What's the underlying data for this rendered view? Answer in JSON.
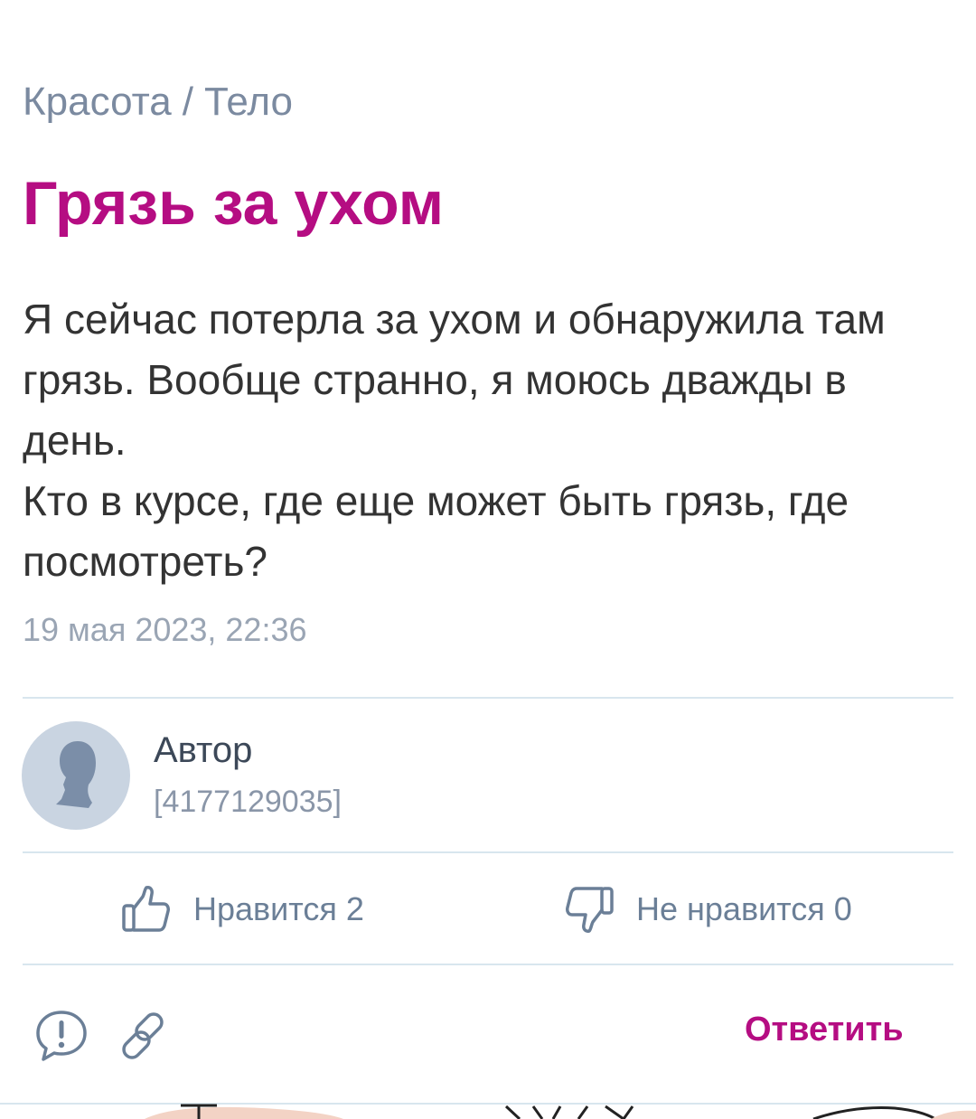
{
  "breadcrumb": {
    "category": "Красота",
    "separator": "/",
    "subcategory": "Тело"
  },
  "post": {
    "title": "Грязь за ухом",
    "body_line1": "Я сейчас потерла за ухом и обнаружила там грязь. Вообще странно, я моюсь дважды в день.",
    "body_line2": "Кто в курсе, где еще может быть грязь, где посмотреть?",
    "timestamp": "19 мая 2023, 22:36"
  },
  "author": {
    "name": "Автор",
    "id": "[4177129035]",
    "avatar_icon": "user-silhouette-icon"
  },
  "votes": {
    "like_label": "Нравится 2",
    "like_icon": "thumbs-up-icon",
    "dislike_label": "Не нравится 0",
    "dislike_icon": "thumbs-down-icon"
  },
  "actions": {
    "report_icon": "report-icon",
    "link_icon": "link-icon",
    "reply_label": "Ответить"
  },
  "colors": {
    "accent": "#b50d82",
    "muted_text": "#7b8aa0",
    "body_text": "#333333",
    "icon": "#6b7f97",
    "divider": "#d8e6ee",
    "avatar_bg": "#c9d4e1"
  }
}
